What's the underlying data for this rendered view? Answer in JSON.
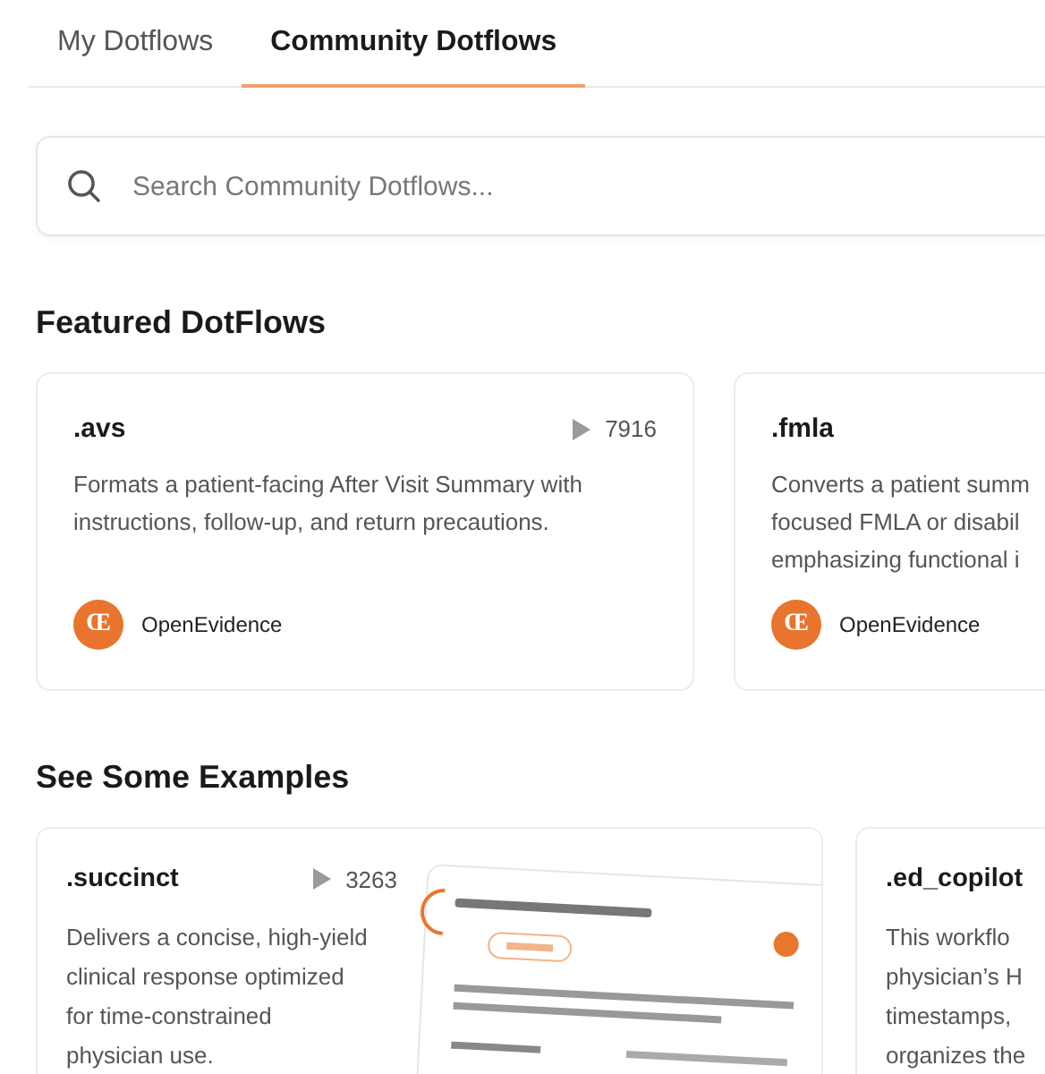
{
  "tabs": [
    {
      "label": "My Dotflows",
      "selected": false
    },
    {
      "label": "Community Dotflows",
      "selected": true
    }
  ],
  "search": {
    "placeholder": "Search Community Dotflows..."
  },
  "featured": {
    "title": "Featured DotFlows",
    "cards": [
      {
        "name": ".avs",
        "runs": "7916",
        "lines": [
          "Formats a patient-facing After Visit Summary with",
          "instructions, follow-up, and return precautions."
        ],
        "author": "OpenEvidence",
        "author_mark": "Œ"
      },
      {
        "name": ".fmla",
        "lines": [
          "Converts a patient summ",
          "focused FMLA or disabil",
          "emphasizing functional i"
        ],
        "author": "OpenEvidence",
        "author_mark": "Œ"
      }
    ]
  },
  "examples": {
    "title": "See Some Examples",
    "cards": [
      {
        "name": ".succinct",
        "runs": "3263",
        "lines": [
          "Delivers a concise, high-yield",
          "clinical response optimized",
          "for time-constrained",
          "physician use."
        ]
      },
      {
        "name": ".ed_copilot",
        "lines": [
          "This workflo",
          "physician’s H",
          "timestamps,",
          "organizes the"
        ]
      }
    ]
  }
}
